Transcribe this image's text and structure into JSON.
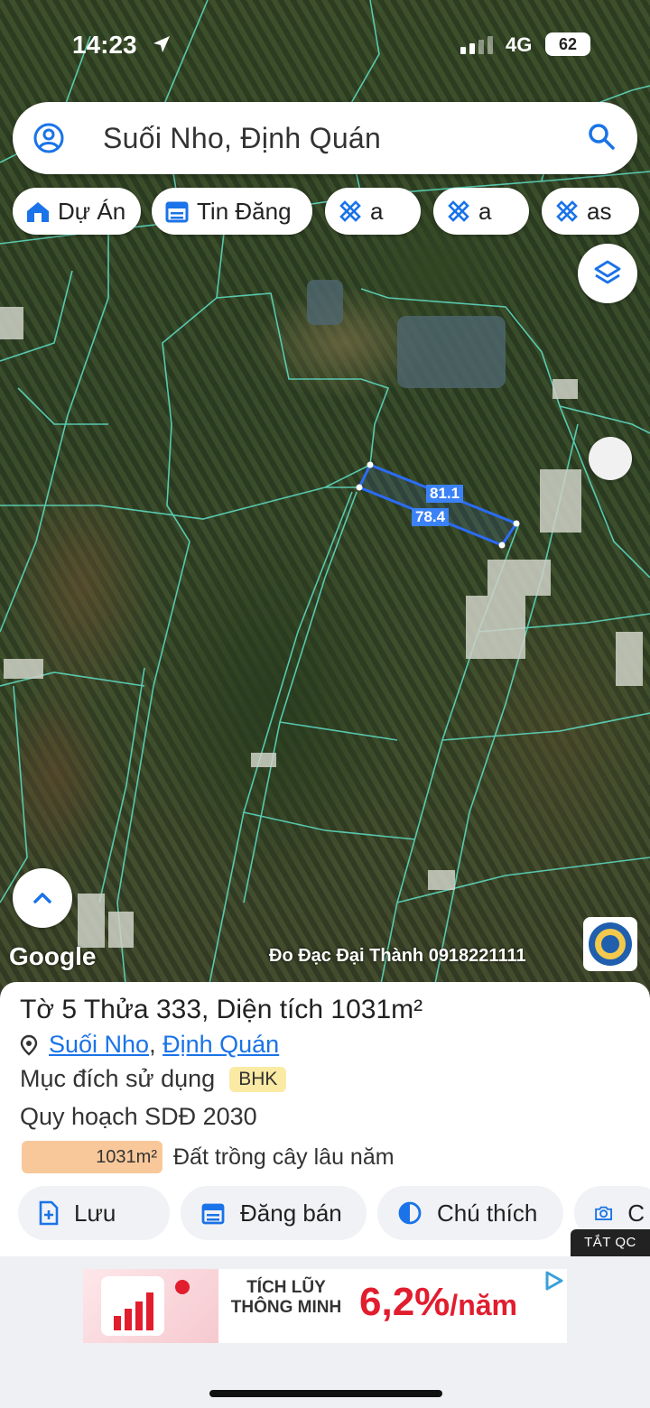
{
  "status_bar": {
    "time": "14:23",
    "network": "4G",
    "battery": "62"
  },
  "search": {
    "query": "Suối Nho, Định Quán"
  },
  "chips": [
    {
      "label": "Dự Án",
      "icon": "house-icon"
    },
    {
      "label": "Tin Đăng",
      "icon": "calendar-icon"
    },
    {
      "label": "a",
      "icon": "ruler-pencil-icon"
    },
    {
      "label": "a",
      "icon": "ruler-pencil-icon"
    },
    {
      "label": "as",
      "icon": "ruler-pencil-icon"
    }
  ],
  "map": {
    "measure_top": "81.1",
    "measure_side": "78.4",
    "attribution": "Google",
    "credit": "Đo Đạc Đại Thành 0918221111"
  },
  "parcel": {
    "title_prefix": "Tờ",
    "sheet": "5",
    "plot_label": "Thửa",
    "plot": "333",
    "area_label": ", Diện tích",
    "area": "1031m²",
    "ward": "Suối Nho",
    "district": "Định Quán",
    "purpose_label": "Mục đích sử dụng",
    "purpose_code": "BHK",
    "planning_label": "Quy hoạch SDĐ 2030",
    "landuse_area": "1031m²",
    "landuse_type": "Đất trồng cây lâu năm"
  },
  "actions": [
    {
      "label": "Lưu",
      "icon": "save-icon"
    },
    {
      "label": "Đăng bán",
      "icon": "calendar-icon"
    },
    {
      "label": "Chú thích",
      "icon": "contrast-icon"
    },
    {
      "label": "C",
      "icon": "camera-icon"
    }
  ],
  "ad": {
    "close_label": "TẮT QC",
    "text_line1": "TÍCH LŨY",
    "text_line2": "THÔNG MINH",
    "rate": "6,2%",
    "rate_unit": "/năm"
  },
  "colors": {
    "accent": "#1a73e8",
    "parcel_outline": "#2b6cf5",
    "boundary_lines": "#5fe0c8",
    "badge": "#fbeaa3",
    "landuse": "#f8c89a"
  }
}
